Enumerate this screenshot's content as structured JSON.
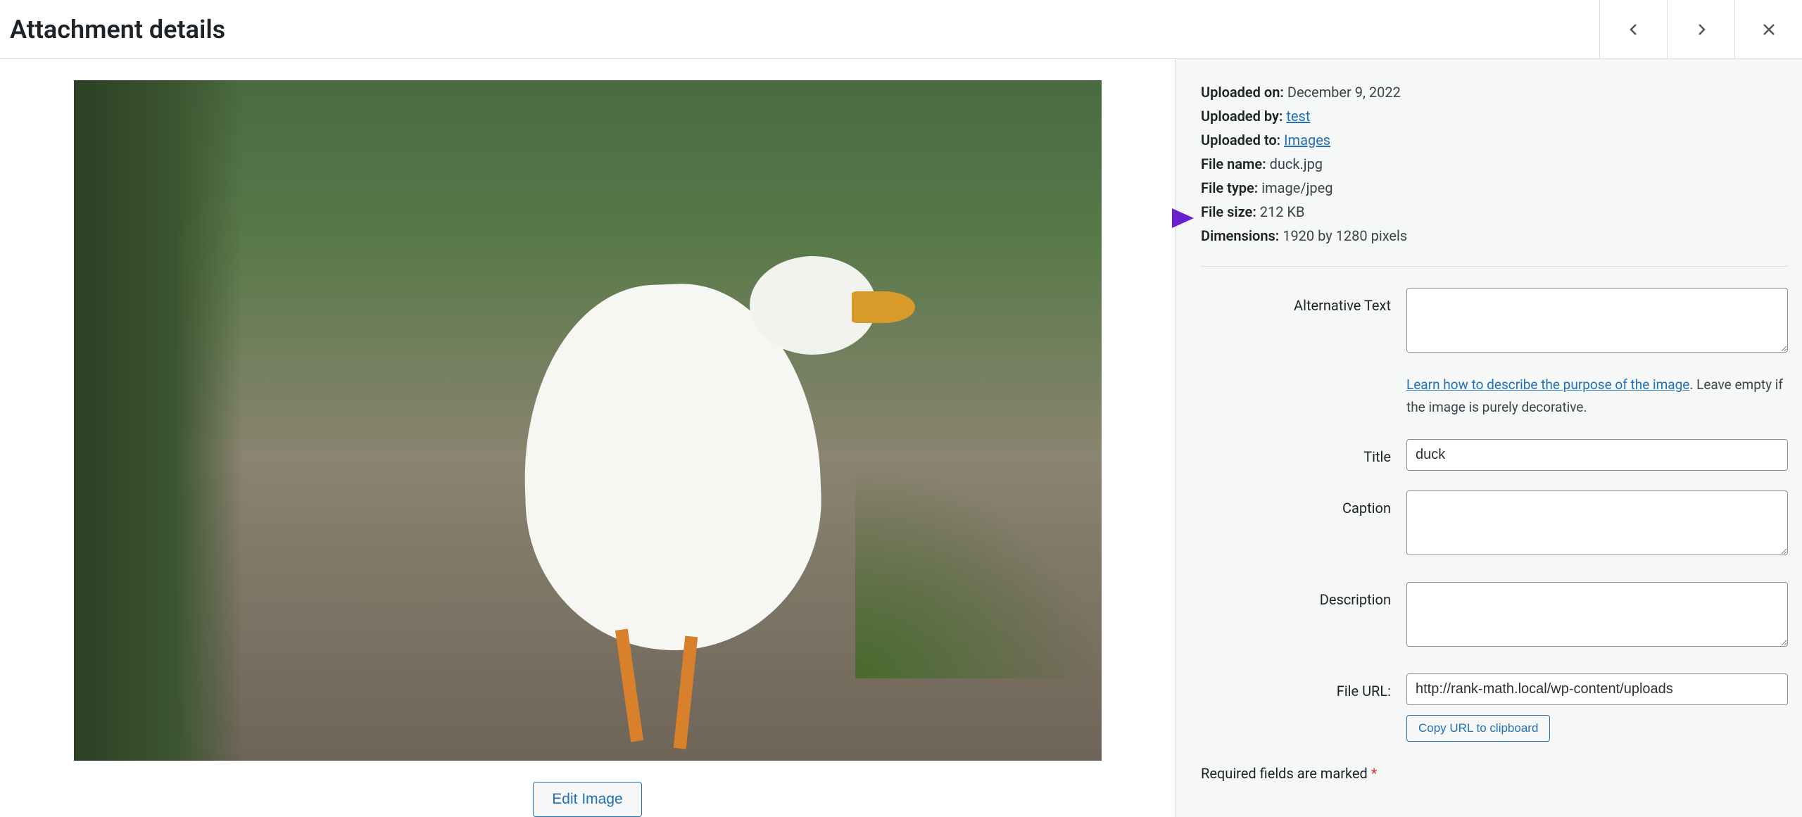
{
  "header": {
    "title": "Attachment details"
  },
  "meta": {
    "uploaded_on_label": "Uploaded on:",
    "uploaded_on": "December 9, 2022",
    "uploaded_by_label": "Uploaded by:",
    "uploaded_by": "test",
    "uploaded_to_label": "Uploaded to:",
    "uploaded_to": "Images",
    "file_name_label": "File name:",
    "file_name": "duck.jpg",
    "file_type_label": "File type:",
    "file_type": "image/jpeg",
    "file_size_label": "File size:",
    "file_size": "212 KB",
    "dimensions_label": "Dimensions:",
    "dimensions": "1920 by 1280 pixels"
  },
  "fields": {
    "alt_label": "Alternative Text",
    "alt_value": "",
    "alt_help_link": "Learn how to describe the purpose of the image",
    "alt_help_suffix": ". Leave empty if the image is purely decorative.",
    "title_label": "Title",
    "title_value": "duck",
    "caption_label": "Caption",
    "caption_value": "",
    "description_label": "Description",
    "description_value": "",
    "file_url_label": "File URL:",
    "file_url_value": "http://rank-math.local/wp-content/uploads",
    "copy_url_label": "Copy URL to clipboard"
  },
  "buttons": {
    "edit_image": "Edit Image"
  },
  "required_note": {
    "text": "Required fields are marked ",
    "asterisk": "*"
  },
  "annotation": {
    "arrow_color": "#8338ec"
  }
}
